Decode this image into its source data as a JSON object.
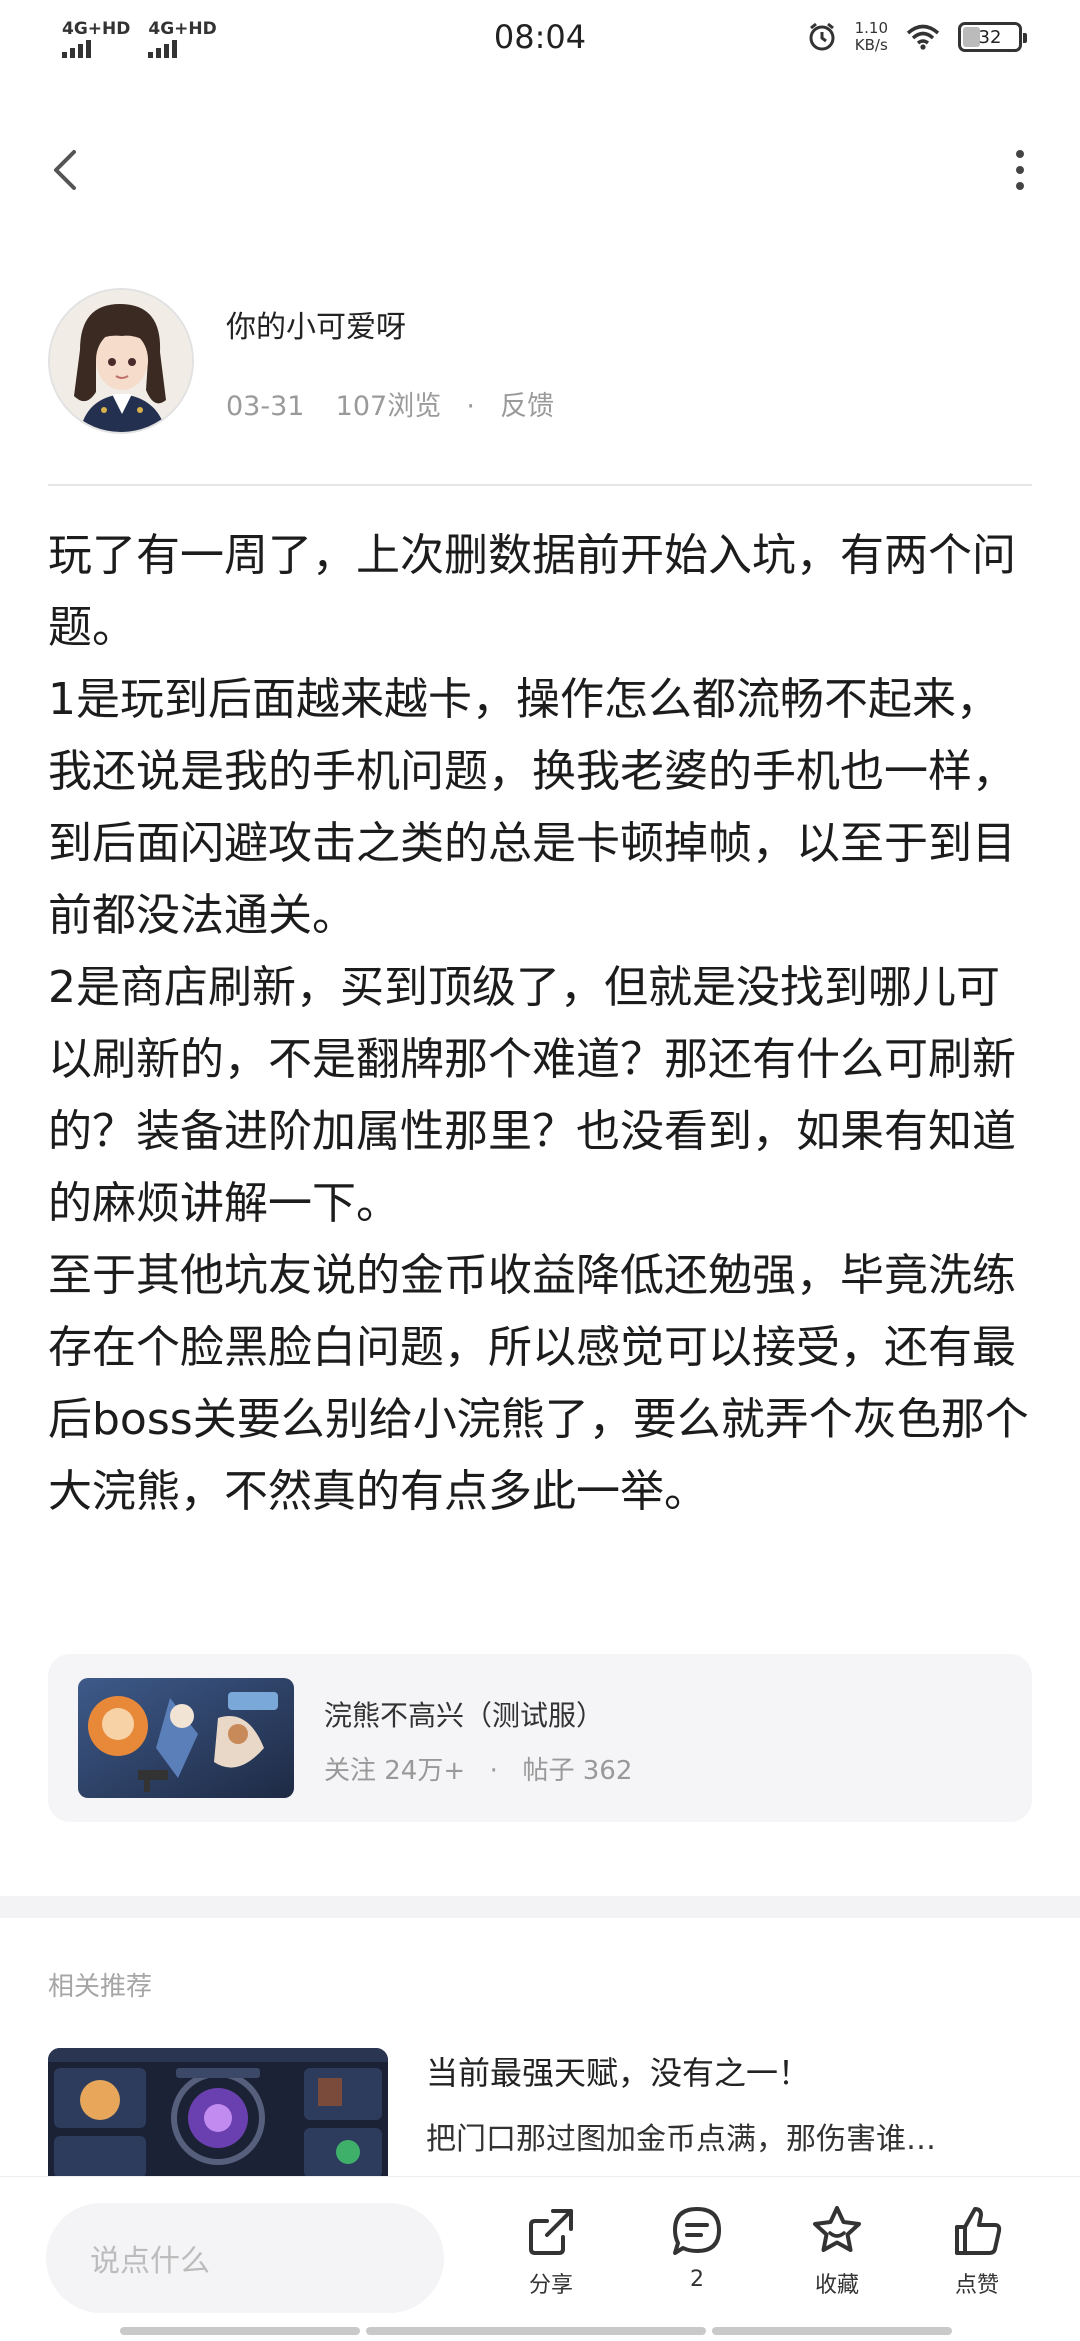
{
  "status_bar": {
    "signal1": "4G+HD",
    "signal2": "4G+HD",
    "time": "08:04",
    "speed_value": "1.10",
    "speed_unit": "KB/s",
    "battery": "32"
  },
  "header": {
    "back_icon": "chevron-left-icon",
    "more_icon": "more-vertical-icon"
  },
  "author": {
    "name": "你的小可爱呀",
    "date": "03-31",
    "views": "107浏览",
    "separator": "·",
    "report": "反馈"
  },
  "post": {
    "body": "玩了有一周了，上次删数据前开始入坑，有两个问题。\n1是玩到后面越来越卡，操作怎么都流畅不起来，我还说是我的手机问题，换我老婆的手机也一样，到后面闪避攻击之类的总是卡顿掉帧，以至于到目前都没法通关。\n2是商店刷新，买到顶级了，但就是没找到哪儿可以刷新的，不是翻牌那个难道？那还有什么可刷新的？装备进阶加属性那里？也没看到，如果有知道的麻烦讲解一下。\n至于其他坑友说的金币收益降低还勉强，毕竟洗练存在个脸黑脸白问题，所以感觉可以接受，还有最后boss关要么别给小浣熊了，要么就弄个灰色那个大浣熊，不然真的有点多此一举。"
  },
  "game_card": {
    "name": "浣熊不高兴（测试服）",
    "followers": "关注 24万+",
    "separator": "·",
    "posts": "帖子 362"
  },
  "related": {
    "section_title": "相关推荐",
    "items": [
      {
        "title": "当前最强天赋，没有之一！",
        "snippet": "把门口那过图加金币点满，那伤害谁…"
      }
    ]
  },
  "bottom_bar": {
    "comment_placeholder": "说点什么",
    "share_label": "分享",
    "comment_count": "2",
    "favorite_label": "收藏",
    "like_label": "点赞"
  }
}
